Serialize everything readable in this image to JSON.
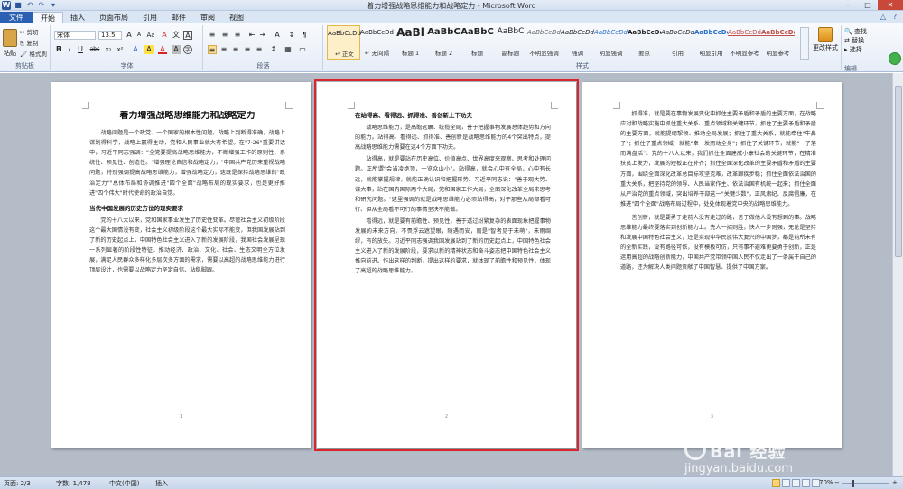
{
  "window": {
    "title": "着力增强战略思维能力和战略定力 - Microsoft Word",
    "minimize": "–",
    "maximize": "□",
    "close": "✕"
  },
  "qat": {
    "word_logo": "W",
    "save": "■",
    "undo": "↶",
    "redo": "↷",
    "customize": "▾"
  },
  "tabs": [
    "文件",
    "开始",
    "插入",
    "页面布局",
    "引用",
    "邮件",
    "审阅",
    "视图"
  ],
  "tab_right": {
    "minimize_ribbon": "△",
    "help": "?"
  },
  "ribbon": {
    "clipboard": {
      "paste": "粘贴",
      "cut": "剪切",
      "copy": "复制",
      "format_painter": "格式刷",
      "label": "剪贴板"
    },
    "font": {
      "name": "宋体",
      "size": "13.5",
      "grow": "A",
      "shrink": "A",
      "case": "Aa",
      "clear": "A",
      "pinyin": "文",
      "border": "A",
      "bold": "B",
      "italic": "I",
      "underline": "U",
      "strike": "abc",
      "sub": "x₂",
      "sup": "x²",
      "effects": "A",
      "highlight": "A",
      "color": "A",
      "shade": "A",
      "circle": "字",
      "label": "字体"
    },
    "paragraph": {
      "label": "段落",
      "bullets": "≡",
      "numbering": "≡",
      "multilevel": "≡",
      "outdent": "⇤",
      "indent": "⇥",
      "chinese_layout": "A",
      "sort": "↕",
      "show_marks": "¶",
      "align_left": "≡",
      "center": "≡",
      "align_right": "≡",
      "justify": "≡",
      "distributed": "≡",
      "spacing": "↕",
      "fill": "▦",
      "borders": "▭"
    },
    "styles": {
      "label": "样式",
      "items": [
        {
          "preview": "AaBbCcDd",
          "name": "↵ 正文"
        },
        {
          "preview": "AaBbCcDd",
          "name": "↵ 无间隔"
        },
        {
          "preview": "AaBl",
          "name": "标题 1"
        },
        {
          "preview": "AaBbC",
          "name": "标题 2"
        },
        {
          "preview": "AaBbC",
          "name": "标题"
        },
        {
          "preview": "AaBbC",
          "name": "副标题"
        },
        {
          "preview": "AaBbCcDd",
          "name": "不明显强调"
        },
        {
          "preview": "AaBbCcDd",
          "name": "强调"
        },
        {
          "preview": "AaBbCcDd",
          "name": "明显强调"
        },
        {
          "preview": "AaBbCcDd",
          "name": "要点"
        },
        {
          "preview": "AaBbCcDd",
          "name": "引用"
        },
        {
          "preview": "AaBbCcDd",
          "name": "明显引用"
        },
        {
          "preview": "AaBbCcDd",
          "name": "不明显参考"
        },
        {
          "preview": "AaBbCcDd",
          "name": "明显参考"
        }
      ],
      "change_styles": "更改样式"
    },
    "editing": {
      "find": "查找",
      "replace": "替换",
      "select": "选择",
      "label": "编辑"
    }
  },
  "pages": {
    "p1": {
      "title": "着力增强战略思维能力和战略定力",
      "para1": "战略问题是一个政党、一个国家的根本性问题。战略上判断得准确，战略上谋划得科学，战略上赢得主动，党和人民事业就大有希望。在\"7·26\"重要讲话中，习近平同志强调：\"全党要提高战略思维能力，不断增强工作的原则性、系统性、预见性、创造性。\"增强理论自信和战略定力，\"中国共产党历来重视战略问题，特别强调提高战略思维能力，增强战略定力，这既是保持战略思维的\"政治定力\"\"总体布局和协调推进\"四个全面\"战略布局的现实要求，也是更好推进\"四个伟大\"时代使命的政治自觉。",
      "head1": "当代中国发展的历史方位的现实要求",
      "para2": "党的十八大以来，党和国家事业发生了历史性变革。尽管社会主义初级阶段这个最大国情没有变，社会主义初级阶段这个最大实际不能变，但我国发展站到了新的历史起点上，中国特色社会主义进入了新的发展阶段，我国社会发展呈现一系列显著的阶段性特征。推动经济、政治、文化、社会、生态文明全方位发展，满足人民群众多样化多层次多方面的需求，需要以高超的战略思维能力进行顶层设计，也需要以战略定力坚定自信、站稳脚跟。",
      "num": "1"
    },
    "p2": {
      "head1": "在站得高、看得远、抓得准、善创新上下功夫",
      "para1": "战略思维能力，是高瞻远瞩、统揽全局，善于把握事物发展总体趋势和方向的能力。站得高、看得远、抓得准、善创新是战略思维能力的4个突出特点，提高战略思维能力需要在这4个方面下功夫。",
      "para2": "站得高，就是要站在历史高位、价值高点、世界高度来观察、思考和处理问题。正所谓\"会当凌绝顶，一览众山小\"。站得高，就会心中有全局，心中有长远，就能掌握规律，就能正确认识和把握形势。习近平同志说：\"善于观大势、谋大事，站在国内国际两个大局，党和国家工作大局，全面深化改革全局来思考和研究问题。\"这里强调的就是战略思维能力必须站得高，对于那些从局部看可行、但从全局看不可行的事情坚决不能做。",
      "para3": "看得远，就是要有前瞻性、预见性，善于透过纷繁复杂的表面现象把握事物发展的未来方向。不畏浮云遮望眼，随遇而安，而是\"智者见于未萌\"，未雨绸缪，有的放矢。习近平同志强调我国发展站到了新的历史起点上，中国特色社会主义进入了新的发展阶段，要求以新的精神状态和奋斗姿态把中国特色社会主义推向前进。作出这样的判断，提出这样的要求，就体现了前瞻性和预见性，体现了高超的战略思维能力。",
      "num": "2"
    },
    "p3": {
      "para1": "抓得准，就是要在事物发展变化中抓住主要矛盾和矛盾的主要方面，在战略应对和战略实施中抓住重大关系、重点领域和关键环节，抓住了主要矛盾和矛盾的主要方面，就能提纲挈领、推动全局发展；抓住了重大关系，就能牵住\"牛鼻子\"；抓住了重点领域，就能\"牵一发而动全身\"；抓住了关键环节，就能\"一子落而满盘活\"。党的十八大以来，我们抓住全面建成小康社会的关键环节，在精准扶贫上发力，发展的短板正在补齐；抓住全面深化改革的主要矛盾和矛盾的主要方面，围绕全面深化改革总目标攻坚克难，改革蹄疾步稳；抓住全面依法治国的重大关系，把坚持党的领导、人民当家作主、依法治国有机统一起来；抓住全面从严治党的重点领域，突出培养干部这一\"关键少数\"，正风肃纪、反腐倡廉，在推进\"四个全面\"战略布局过程中，处处体现着党中央的战略思维能力。",
      "para2": "善创新，就是要勇于走前人没有走过的路，善于做他人没有想到的事。战略思维能力最终要落实到创新能力上。先人一招则胜，快人一步则强，无论是坚持和发展中国特色社会主义，还是实现中华民族伟大复兴的中国梦，都是前所未有的全新实践，没有路径可依，没有模板可仿，只有事不避难更要勇于创新，正是运用高超的战略创新能力，中国共产党带领中国人民不仅走出了一条属于自己的道路，还为解决人类问题贡献了中国智慧、提供了中国方案。",
      "num": "3"
    }
  },
  "status": {
    "page": "页面: 2/3",
    "words": "字数: 1,478",
    "lang": "中文(中国)",
    "mode": "插入",
    "zoom": "70%",
    "zoom_minus": "−",
    "zoom_plus": "+"
  },
  "watermark": {
    "cn": "Bai 经验",
    "en": "jingyan.baidu.com"
  }
}
